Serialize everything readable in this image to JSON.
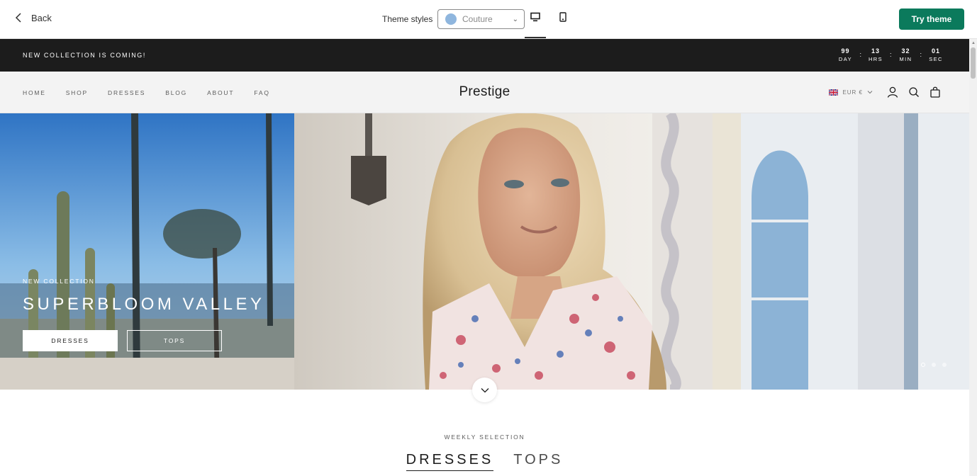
{
  "toolbar": {
    "back_label": "Back",
    "theme_styles_label": "Theme styles",
    "theme_style_value": "Couture",
    "theme_swatch_color": "#8fb6de",
    "try_theme_label": "Try theme",
    "try_theme_color": "#0b7a5c",
    "devices": [
      "desktop-icon",
      "mobile-icon"
    ]
  },
  "announcement": {
    "text": "NEW COLLECTION IS COMING!",
    "countdown": [
      {
        "value": "99",
        "label": "DAY"
      },
      {
        "value": "13",
        "label": "HRS"
      },
      {
        "value": "32",
        "label": "MIN"
      },
      {
        "value": "01",
        "label": "SEC"
      }
    ]
  },
  "header": {
    "nav": [
      "HOME",
      "SHOP",
      "DRESSES",
      "BLOG",
      "ABOUT",
      "FAQ"
    ],
    "logo": "Prestige",
    "currency": "EUR €"
  },
  "hero": {
    "eyebrow": "NEW COLLECTION",
    "title": "SUPERBLOOM VALLEY",
    "buttons": [
      "DRESSES",
      "TOPS"
    ],
    "slides": 3,
    "active_slide": 1
  },
  "weekly": {
    "eyebrow": "WEEKLY SELECTION",
    "tabs": [
      "DRESSES",
      "TOPS"
    ],
    "active_tab": "DRESSES"
  }
}
